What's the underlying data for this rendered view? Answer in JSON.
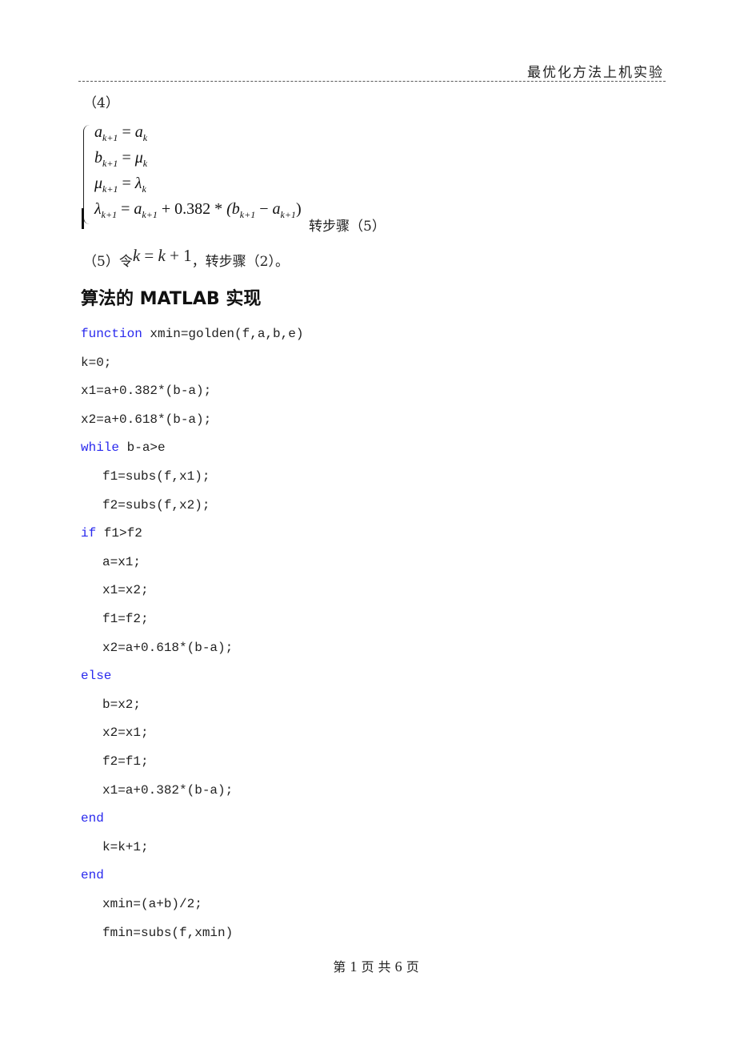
{
  "header": {
    "title": "最优化方法上机实验"
  },
  "step4": {
    "label": "（4）",
    "equations": [
      {
        "lhs": "a",
        "lhs_sub": "k+1",
        "rhs": "a",
        "rhs_sub": "k"
      },
      {
        "lhs": "b",
        "lhs_sub": "k+1",
        "rhs": "μ",
        "rhs_sub": "k"
      },
      {
        "lhs": "μ",
        "lhs_sub": "k+1",
        "rhs": "λ",
        "rhs_sub": "k"
      },
      {
        "lhs": "λ",
        "lhs_sub": "k+1",
        "rhs_full": "a_{k+1} + 0.382 * (b_{k+1} − a_{k+1})"
      }
    ],
    "tail": "转步骤（5）"
  },
  "step5": {
    "prefix": "（5）令",
    "math": "k = k + 1",
    "suffix": "，转步骤（2）。"
  },
  "section": {
    "heading": "算法的 MATLAB 实现"
  },
  "code": {
    "keyword_color": "#2a2aee",
    "lines": [
      {
        "kw": "function",
        "text": " xmin=golden(f,a,b,e)",
        "indent": false
      },
      {
        "kw": "",
        "text": "k=0;",
        "indent": false
      },
      {
        "kw": "",
        "text": "x1=a+0.382*(b-a);",
        "indent": false
      },
      {
        "kw": "",
        "text": "x2=a+0.618*(b-a);",
        "indent": false
      },
      {
        "kw": "while",
        "text": " b-a>e",
        "indent": false
      },
      {
        "kw": "",
        "text": "f1=subs(f,x1);",
        "indent": true
      },
      {
        "kw": "",
        "text": "f2=subs(f,x2);",
        "indent": true
      },
      {
        "kw": "if",
        "text": " f1>f2",
        "indent": false
      },
      {
        "kw": "",
        "text": "a=x1;",
        "indent": true
      },
      {
        "kw": "",
        "text": "x1=x2;",
        "indent": true
      },
      {
        "kw": "",
        "text": "f1=f2;",
        "indent": true
      },
      {
        "kw": "",
        "text": "x2=a+0.618*(b-a);",
        "indent": true
      },
      {
        "kw": "else",
        "text": "",
        "indent": false
      },
      {
        "kw": "",
        "text": "b=x2;",
        "indent": true
      },
      {
        "kw": "",
        "text": "x2=x1;",
        "indent": true
      },
      {
        "kw": "",
        "text": "f2=f1;",
        "indent": true
      },
      {
        "kw": "",
        "text": "x1=a+0.382*(b-a);",
        "indent": true
      },
      {
        "kw": "end",
        "text": "",
        "indent": false
      },
      {
        "kw": "",
        "text": "k=k+1;",
        "indent": true
      },
      {
        "kw": "end",
        "text": "",
        "indent": false
      },
      {
        "kw": "",
        "text": "xmin=(a+b)/2;",
        "indent": true
      },
      {
        "kw": "",
        "text": "fmin=subs(f,xmin)",
        "indent": true
      }
    ]
  },
  "footer": {
    "pre": "第",
    "page": "1",
    "mid": "页 共",
    "total": "6",
    "post": "页"
  }
}
